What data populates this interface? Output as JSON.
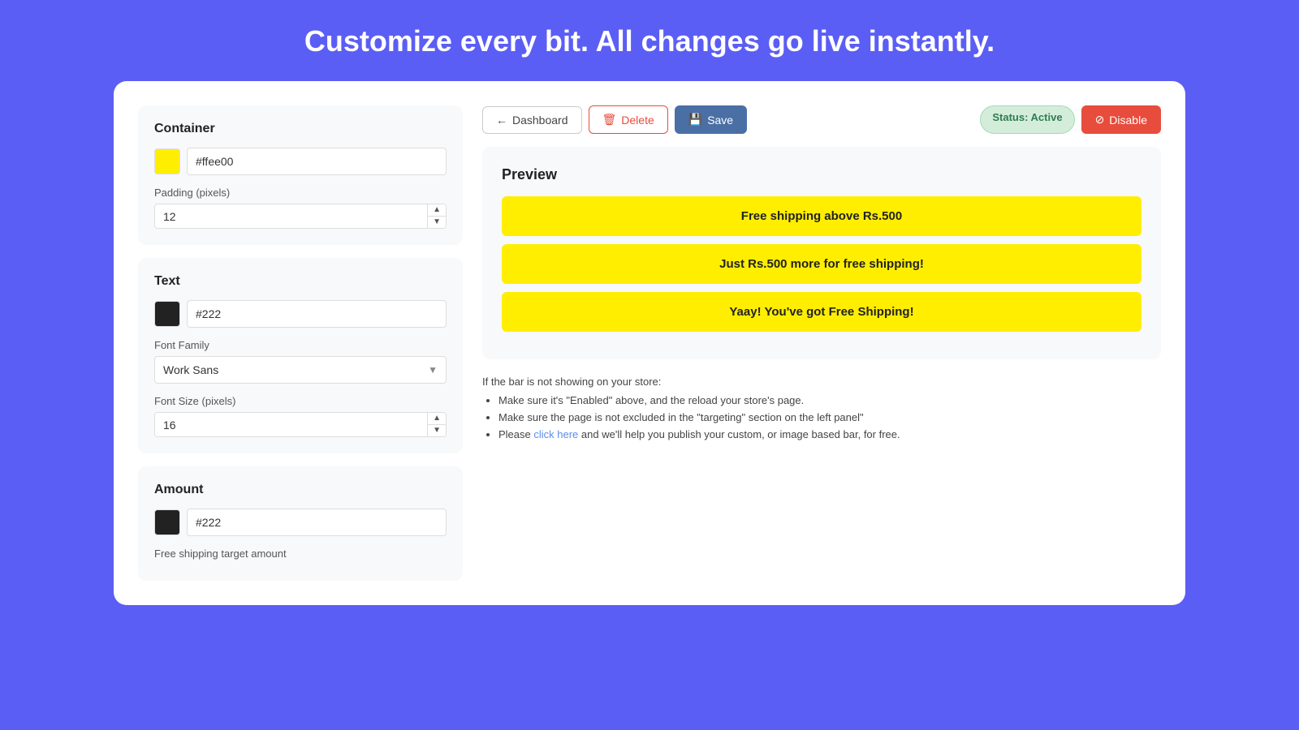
{
  "headline": "Customize every bit. All changes go live instantly.",
  "toolbar": {
    "dashboard_label": "Dashboard",
    "delete_label": "Delete",
    "save_label": "Save",
    "status_label": "Status: Active",
    "disable_label": "Disable"
  },
  "left_panel": {
    "container_section": {
      "title": "Container",
      "color_value": "#ffee00",
      "padding_label": "Padding (pixels)",
      "padding_value": "12"
    },
    "text_section": {
      "title": "Text",
      "color_value": "#222",
      "font_family_label": "Font Family",
      "font_family_value": "Work Sans",
      "font_size_label": "Font Size (pixels)",
      "font_size_value": "16"
    },
    "amount_section": {
      "title": "Amount",
      "color_value": "#222",
      "free_shipping_label": "Free shipping target amount"
    }
  },
  "preview": {
    "title": "Preview",
    "bars": [
      {
        "text": "Free shipping above Rs.500"
      },
      {
        "text": "Just Rs.500 more for free shipping!"
      },
      {
        "text": "Yaay! You've got Free Shipping!"
      }
    ],
    "info_heading": "If the bar is not showing on your store:",
    "info_items": [
      "Make sure it's \"Enabled\" above, and the reload your store's page.",
      "Make sure the page is not excluded in the \"targeting\" section on the left panel\"",
      "Please click here and we'll help you publish your custom, or image based bar, for free."
    ],
    "click_here_text": "click here"
  }
}
